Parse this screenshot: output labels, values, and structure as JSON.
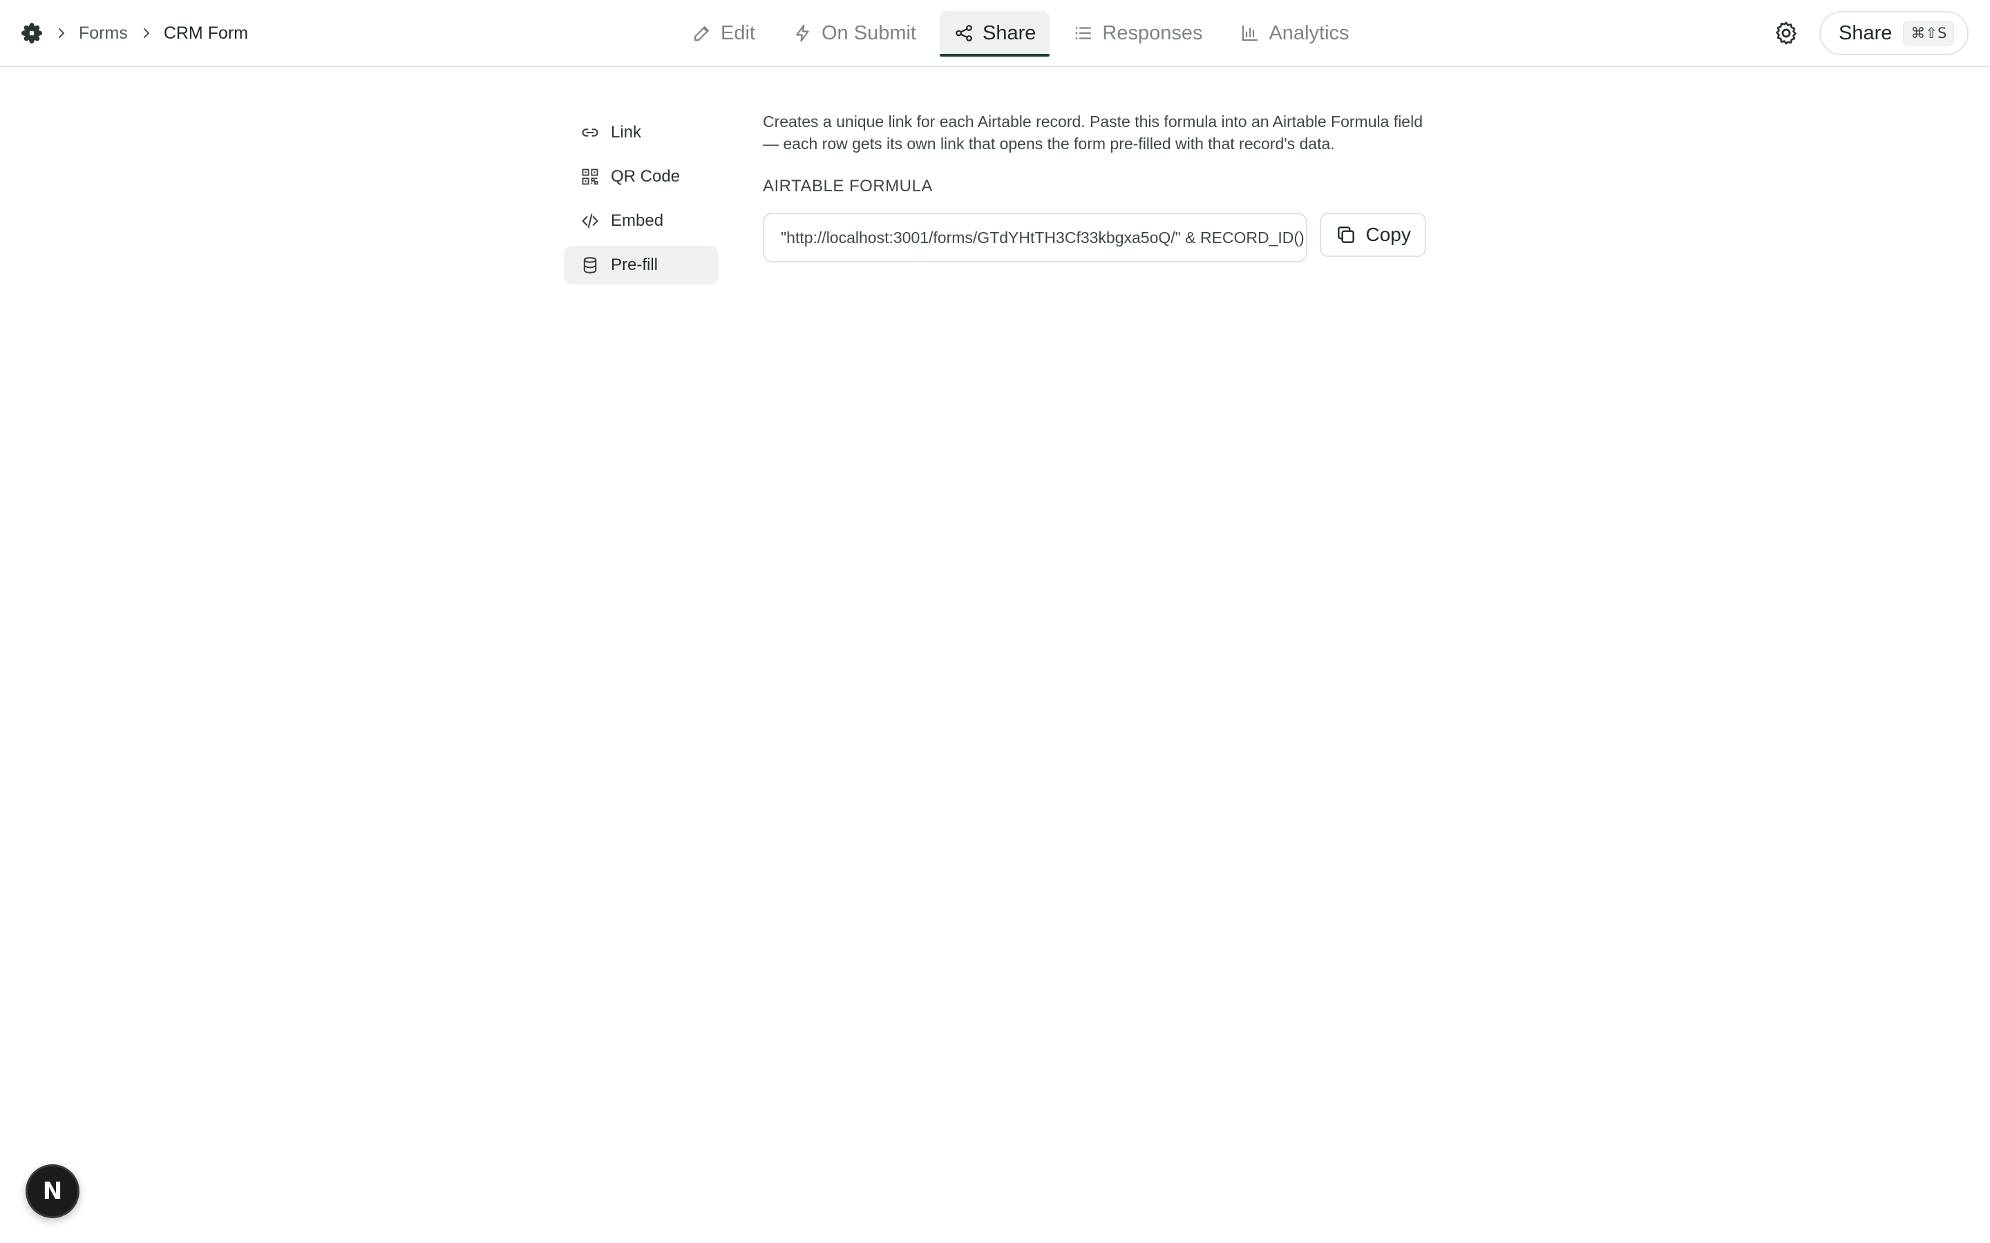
{
  "header": {
    "breadcrumb": [
      "Forms",
      "CRM Form"
    ],
    "tabs": [
      {
        "label": "Edit",
        "icon": "pencil-icon"
      },
      {
        "label": "On Submit",
        "icon": "lightning-icon"
      },
      {
        "label": "Share",
        "icon": "share-icon",
        "active": true
      },
      {
        "label": "Responses",
        "icon": "list-icon"
      },
      {
        "label": "Analytics",
        "icon": "bar-chart-icon"
      }
    ],
    "share_button": {
      "label": "Share",
      "shortcut": "⌘⇧S"
    }
  },
  "sidebar": {
    "items": [
      {
        "label": "Link",
        "icon": "link-icon"
      },
      {
        "label": "QR Code",
        "icon": "qr-code-icon"
      },
      {
        "label": "Embed",
        "icon": "code-icon"
      },
      {
        "label": "Pre-fill",
        "icon": "database-icon",
        "active": true
      }
    ]
  },
  "content": {
    "description": "Creates a unique link for each Airtable record. Paste this formula into an Airtable Formula field — each row gets its own link that opens the form pre-filled with that record's data.",
    "label": "AIRTABLE FORMULA",
    "formula": "\"http://localhost:3001/forms/GTdYHtTH3Cf33kbgxa5oQ/\" & RECORD_ID()",
    "copy_label": "Copy"
  },
  "badge": {
    "letter": "N"
  },
  "colors": {
    "accent": "#1f3b2e",
    "active_bg": "#eef1ee",
    "border": "#dfe3df"
  }
}
